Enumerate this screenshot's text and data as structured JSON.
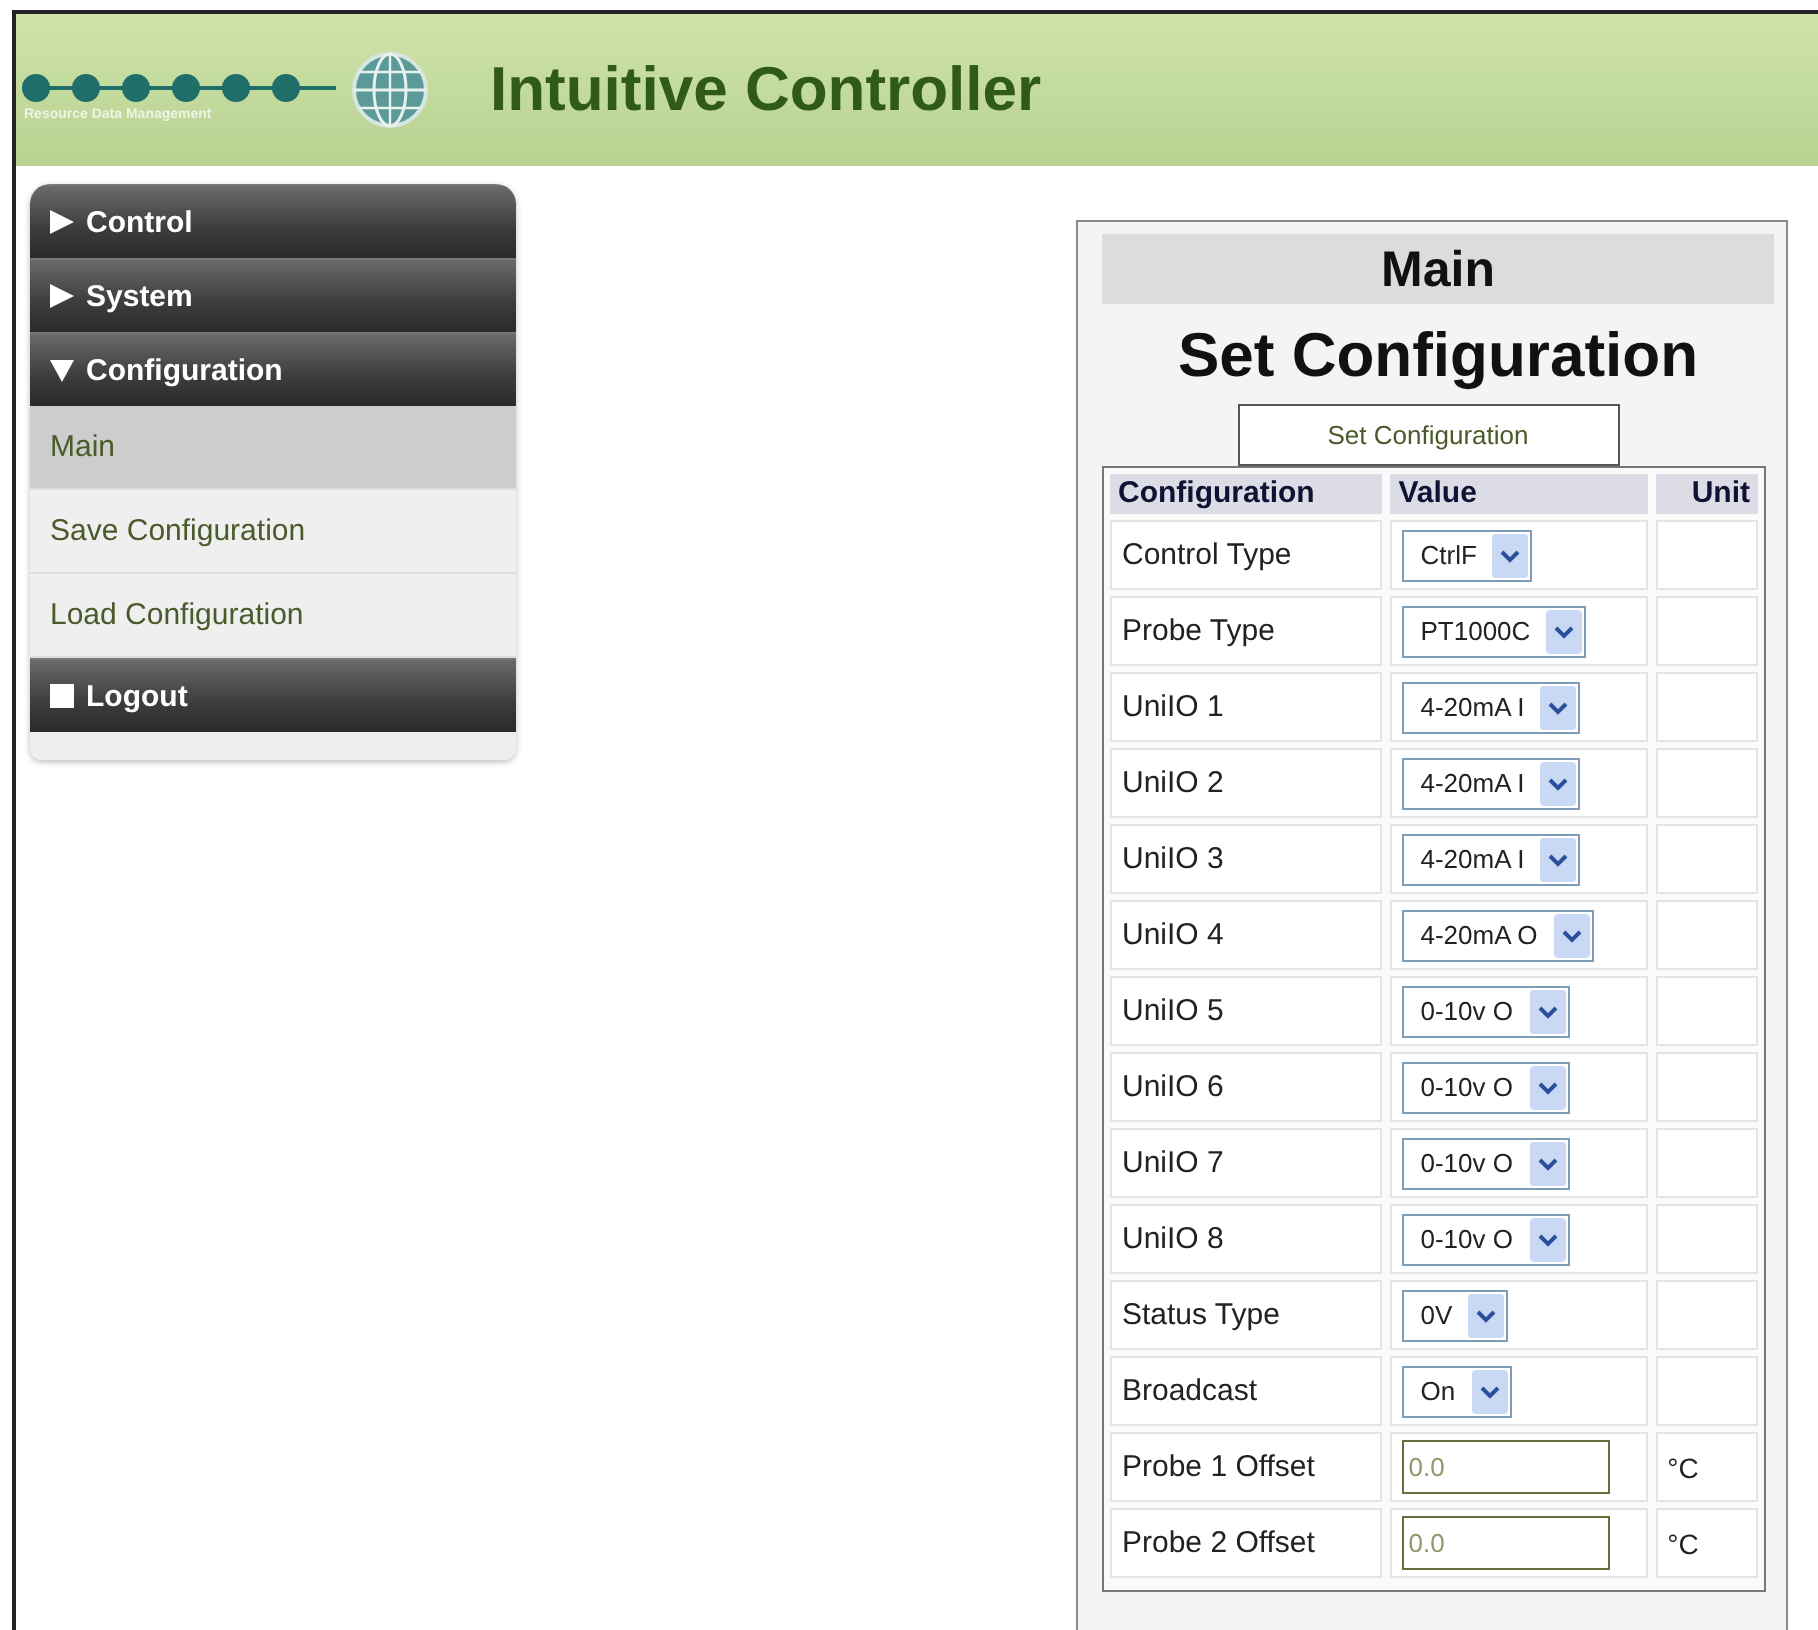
{
  "header": {
    "logo_caption": "Resource Data Management",
    "title": "Intuitive Controller"
  },
  "sidebar": [
    {
      "label": "Control",
      "kind": "section",
      "expanded": false
    },
    {
      "label": "System",
      "kind": "section",
      "expanded": false
    },
    {
      "label": "Configuration",
      "kind": "section",
      "expanded": true,
      "children": [
        {
          "label": "Main",
          "selected": true
        },
        {
          "label": "Save Configuration",
          "selected": false
        },
        {
          "label": "Load Configuration",
          "selected": false
        }
      ]
    },
    {
      "label": "Logout",
      "kind": "action"
    }
  ],
  "panel": {
    "heading": "Main",
    "title": "Set Configuration",
    "button": "Set Configuration",
    "table": {
      "columns": [
        "Configuration",
        "Value",
        "Unit"
      ],
      "rows": [
        {
          "label": "Control Type",
          "kind": "select",
          "value": "CtrlF"
        },
        {
          "label": "Probe Type",
          "kind": "select",
          "value": "PT1000C"
        },
        {
          "label": "UniIO 1",
          "kind": "select",
          "value": "4-20mA I"
        },
        {
          "label": "UniIO 2",
          "kind": "select",
          "value": "4-20mA I"
        },
        {
          "label": "UniIO 3",
          "kind": "select",
          "value": "4-20mA I"
        },
        {
          "label": "UniIO 4",
          "kind": "select",
          "value": "4-20mA O"
        },
        {
          "label": "UniIO 5",
          "kind": "select",
          "value": "0-10v O"
        },
        {
          "label": "UniIO 6",
          "kind": "select",
          "value": "0-10v O"
        },
        {
          "label": "UniIO 7",
          "kind": "select",
          "value": "0-10v O"
        },
        {
          "label": "UniIO 8",
          "kind": "select",
          "value": "0-10v O"
        },
        {
          "label": "Status Type",
          "kind": "select",
          "value": "0V"
        },
        {
          "label": "Broadcast",
          "kind": "select",
          "value": "On"
        },
        {
          "label": "Probe 1 Offset",
          "kind": "input",
          "value": "0.0",
          "unit": "°C"
        },
        {
          "label": "Probe 2 Offset",
          "kind": "input",
          "value": "0.0",
          "unit": "°C"
        }
      ]
    }
  }
}
